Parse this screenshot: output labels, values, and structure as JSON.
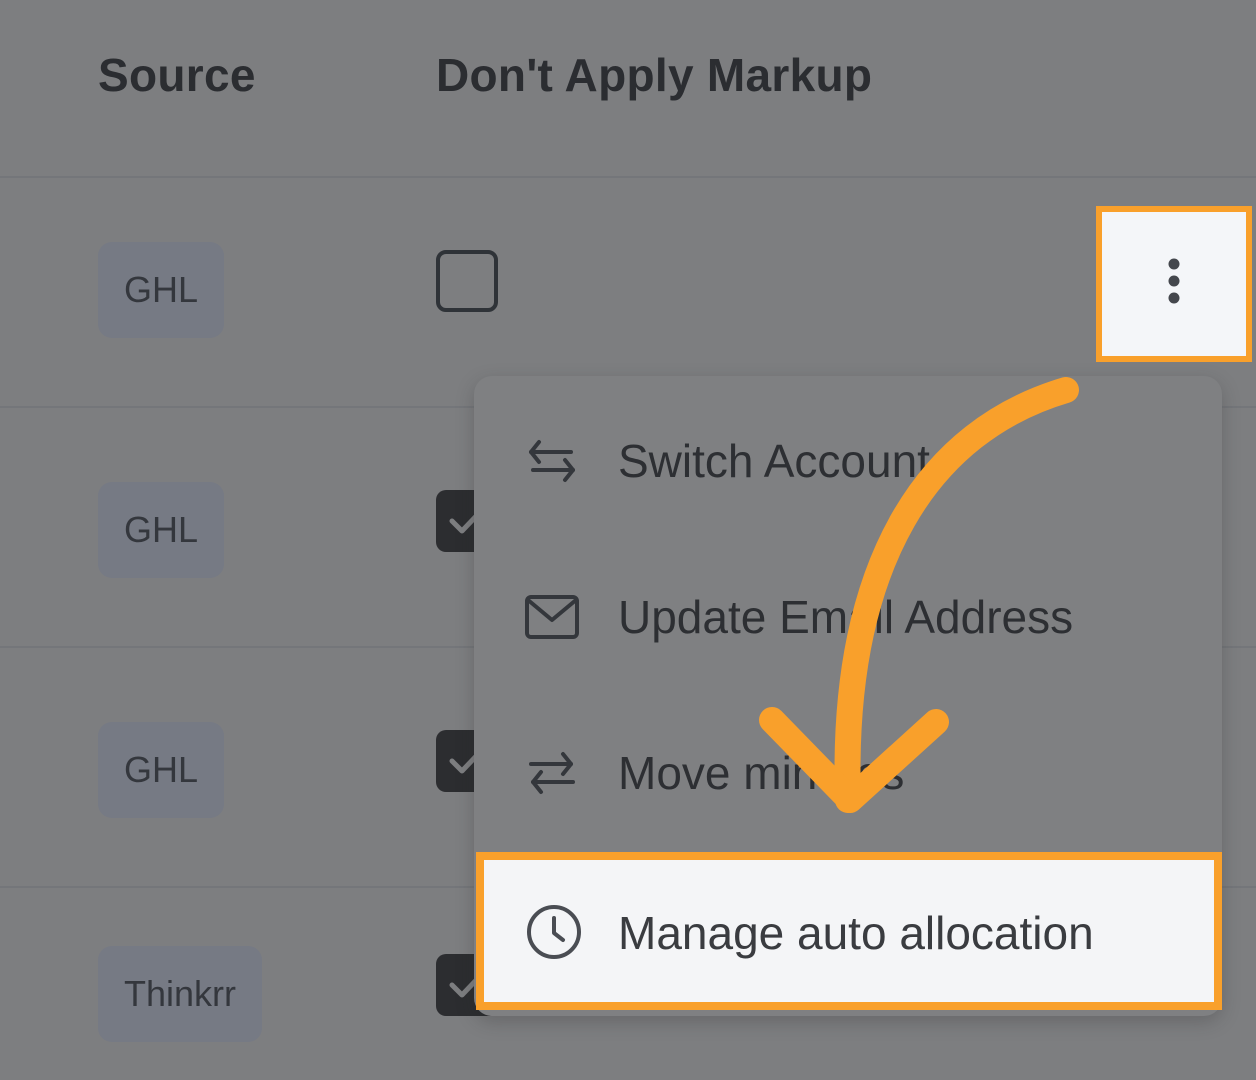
{
  "table": {
    "headers": {
      "source": "Source",
      "dont_apply_markup": "Don't Apply Markup"
    },
    "rows": [
      {
        "source": "GHL",
        "dont_apply_markup": false
      },
      {
        "source": "GHL",
        "dont_apply_markup": true
      },
      {
        "source": "GHL",
        "dont_apply_markup": true
      },
      {
        "source": "Thinkrr",
        "dont_apply_markup": true
      }
    ]
  },
  "row_actions": {
    "icon": "kebab-vertical-icon"
  },
  "menu": {
    "items": [
      {
        "label": "Switch Account",
        "icon": "switch-arrows-icon"
      },
      {
        "label": "Update Email Address",
        "icon": "envelope-icon"
      },
      {
        "label": "Move minutes",
        "icon": "transfer-arrows-icon"
      },
      {
        "label": "Manage auto allocation",
        "icon": "clock-icon"
      }
    ]
  },
  "colors": {
    "highlight": "#f9a02b",
    "overlay": "#7d7e80"
  }
}
